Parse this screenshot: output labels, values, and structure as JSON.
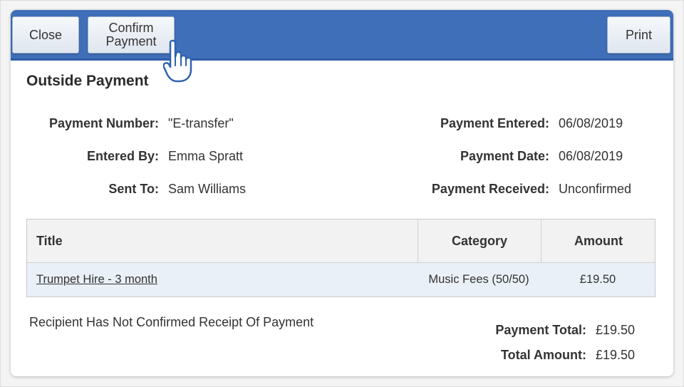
{
  "toolbar": {
    "close_label": "Close",
    "confirm_label": "Confirm\nPayment",
    "print_label": "Print"
  },
  "section_title": "Outside Payment",
  "details_left": [
    {
      "label": "Payment Number:",
      "value": "\"E-transfer\""
    },
    {
      "label": "Entered By:",
      "value": "Emma Spratt"
    },
    {
      "label": "Sent To:",
      "value": "Sam Williams"
    }
  ],
  "details_right": [
    {
      "label": "Payment Entered:",
      "value": "06/08/2019"
    },
    {
      "label": "Payment Date:",
      "value": "06/08/2019"
    },
    {
      "label": "Payment Received:",
      "value": "Unconfirmed"
    }
  ],
  "table": {
    "headers": [
      "Title",
      "Category",
      "Amount"
    ],
    "rows": [
      {
        "title": "Trumpet Hire - 3 month",
        "category": "Music Fees (50/50)",
        "amount": "£19.50"
      }
    ]
  },
  "notice": "Recipient Has Not Confirmed Receipt Of Payment",
  "totals": {
    "payment_total_label": "Payment Total:",
    "payment_total_value": "£19.50",
    "total_amount_label": "Total Amount:",
    "total_amount_value": "£19.50"
  },
  "cursor_icon": "hand-pointer-icon",
  "colors": {
    "toolbar": "#3f6fb8",
    "row_highlight": "#e9f0f7"
  }
}
